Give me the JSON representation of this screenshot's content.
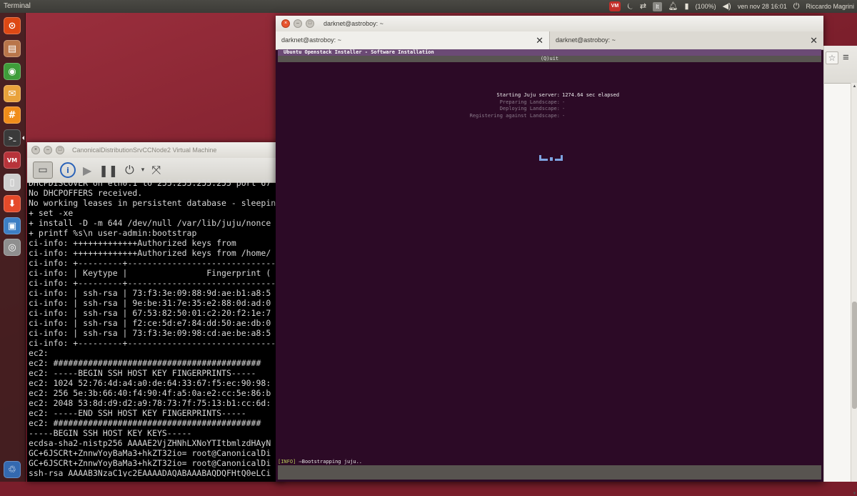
{
  "top_panel": {
    "app_title": "Terminal",
    "indicators": {
      "vm_badge": "VM",
      "keyboard": "It",
      "battery": "(100%)",
      "datetime": "ven nov 28 16:01",
      "user": "Riccardo Magrini"
    }
  },
  "launcher": {
    "items": [
      {
        "name": "ubuntu-software-center",
        "glyph": "⊙",
        "color": "#dd4814"
      },
      {
        "name": "files",
        "glyph": "▤",
        "color": "#b9754a"
      },
      {
        "name": "chromium",
        "glyph": "◉",
        "color": "#3f9d3a"
      },
      {
        "name": "mail",
        "glyph": "✉",
        "color": "#e9a23b"
      },
      {
        "name": "hashtag-app",
        "glyph": "#",
        "color": "#f08c1a"
      },
      {
        "name": "terminal",
        "glyph": ">_",
        "color": "#3a3a3a"
      },
      {
        "name": "vmware",
        "glyph": "VM",
        "color": "#b7333a"
      },
      {
        "name": "text-editor",
        "glyph": "▯",
        "color": "#cfcfcf"
      },
      {
        "name": "download-manager",
        "glyph": "⬇",
        "color": "#e54a2a"
      },
      {
        "name": "remote-desktop",
        "glyph": "▣",
        "color": "#3d7ec4"
      },
      {
        "name": "disk-utility",
        "glyph": "◎",
        "color": "#8f8f8f"
      },
      {
        "name": "trash",
        "glyph": "♲",
        "color": "#3469b0"
      }
    ]
  },
  "vm_window": {
    "title": "CanonicalDistributionSrvCCNode2 Virtual Machine",
    "console_lines": [
      "DHCPDISCOVER on eth0.1 to 255.255.255.255 port 67",
      "No DHCPOFFERS received.",
      "No working leases in persistent database - sleeping",
      "+ set -xe",
      "+ install -D -m 644 /dev/null /var/lib/juju/nonce",
      "+ printf %s\\n user-admin:bootstrap",
      "ci-info: +++++++++++++Authorized keys from",
      "ci-info: +++++++++++++Authorized keys from /home/",
      "ci-info: +---------+------------------------------",
      "ci-info: | Keytype |                Fingerprint (",
      "ci-info: +---------+------------------------------",
      "ci-info: | ssh-rsa | 73:f3:3e:09:88:9d:ae:b1:a8:5",
      "ci-info: | ssh-rsa | 9e:be:31:7e:35:e2:88:0d:ad:0",
      "ci-info: | ssh-rsa | 67:53:82:50:01:c2:20:f2:1e:7",
      "ci-info: | ssh-rsa | f2:ce:5d:e7:84:dd:50:ae:db:0",
      "ci-info: | ssh-rsa | 73:f3:3e:09:98:cd:ae:be:a8:5",
      "ci-info: +---------+------------------------------",
      "ec2:",
      "ec2: ##########################################",
      "ec2: -----BEGIN SSH HOST KEY FINGERPRINTS-----",
      "ec2: 1024 52:76:4d:a4:a0:de:64:33:67:f5:ec:90:98:",
      "ec2: 256 5e:3b:66:40:f4:90:4f:a5:0a:e2:cc:5e:86:b",
      "ec2: 2048 53:8d:d9:d2:a9:78:73:7f:75:13:b1:cc:6d:",
      "ec2: -----END SSH HOST KEY FINGERPRINTS-----",
      "ec2: ##########################################",
      "-----BEGIN SSH HOST KEY KEYS-----",
      "ecdsa-sha2-nistp256 AAAAE2VjZHNhLXNoYTItbmlzdHAyN",
      "GC+6JSCRt+ZnnwYoyBaMa3+hkZT32io= root@CanonicalDi",
      "GC+6JSCRt+ZnnwYoyBaMa3+hkZT32io= root@CanonicalDi",
      "ssh-rsa AAAAB3NzaC1yc2EAAAADAQABAAABAQDQFHtQ0eLCi"
    ]
  },
  "terminal_window": {
    "title": "darknet@astroboy: ~",
    "tabs": [
      {
        "label": "darknet@astroboy: ~",
        "active": true
      },
      {
        "label": "darknet@astroboy: ~",
        "active": false
      }
    ],
    "installer": {
      "header": "Ubuntu Openstack Installer - Software Installation",
      "quit": "(Q)uit",
      "status_rows": [
        {
          "label": "Starting Juju server:",
          "value": "1274.64 sec elapsed",
          "state": "active"
        },
        {
          "label": "Preparing Landscape:",
          "value": "-",
          "state": "pending"
        },
        {
          "label": "Deploying Landscape:",
          "value": "-",
          "state": "pending"
        },
        {
          "label": "Registering against Landscape:",
          "value": "-",
          "state": "pending"
        }
      ],
      "info_tag": "[INFO]",
      "info_message": "⇨Bootstrapping juju.."
    }
  },
  "colors": {
    "terminal_bg": "#2c0a26",
    "installer_header_bg": "#6b4a75",
    "bar_bg": "#585450",
    "info_tag": "#b7c95a",
    "wallpaper": "#7a1e2b"
  }
}
